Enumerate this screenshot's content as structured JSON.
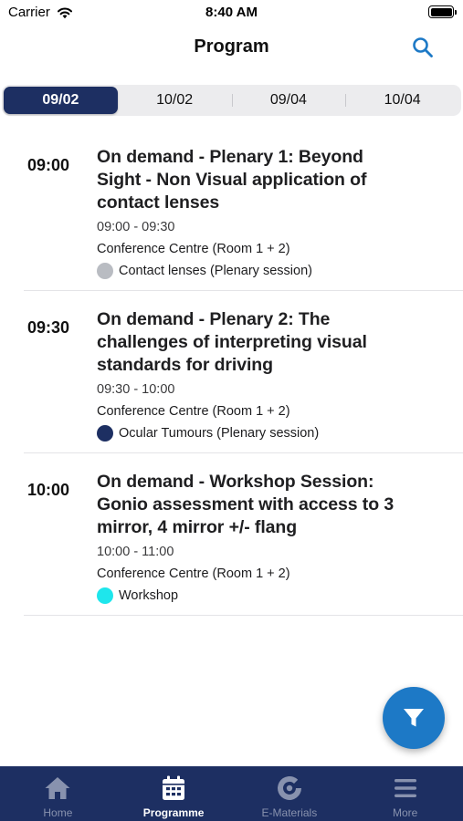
{
  "status_bar": {
    "carrier": "Carrier",
    "time": "8:40 AM"
  },
  "nav": {
    "title": "Program",
    "search_icon": "search-icon"
  },
  "dates": [
    "09/02",
    "10/02",
    "09/04",
    "10/04"
  ],
  "selected_date": "09/02",
  "sessions": [
    {
      "time": "09:00",
      "title": "On demand - Plenary 1: Beyond Sight - Non Visual application of contact lenses",
      "hours": "09:00 - 09:30",
      "room": "Conference Centre (Room 1 + 2)",
      "category": "Contact lenses (Plenary session)",
      "category_color": "#b9bcc2"
    },
    {
      "time": "09:30",
      "title": "On demand - Plenary 2: The challenges of interpreting visual standards for driving",
      "hours": "09:30 - 10:00",
      "room": "Conference Centre (Room 1 + 2)",
      "category": "Ocular Tumours (Plenary session)",
      "category_color": "#1d2f62"
    },
    {
      "time": "10:00",
      "title": "On demand - Workshop Session: Gonio assessment with access to 3 mirror, 4 mirror +/- flang",
      "hours": "10:00 - 11:00",
      "room": "Conference Centre (Room 1 + 2)",
      "category": "Workshop",
      "category_color": "#1ee6ec"
    }
  ],
  "fab": {
    "icon": "filter-icon"
  },
  "tabs": [
    {
      "label": "Home",
      "icon": "home-icon"
    },
    {
      "label": "Programme",
      "icon": "calendar-icon"
    },
    {
      "label": "E-Materials",
      "icon": "e-materials-icon"
    },
    {
      "label": "More",
      "icon": "menu-icon"
    }
  ],
  "active_tab": "Programme",
  "colors": {
    "brand_navy": "#1d2f62",
    "accent_blue": "#1d79c6",
    "tab_inactive": "#8892ae"
  }
}
